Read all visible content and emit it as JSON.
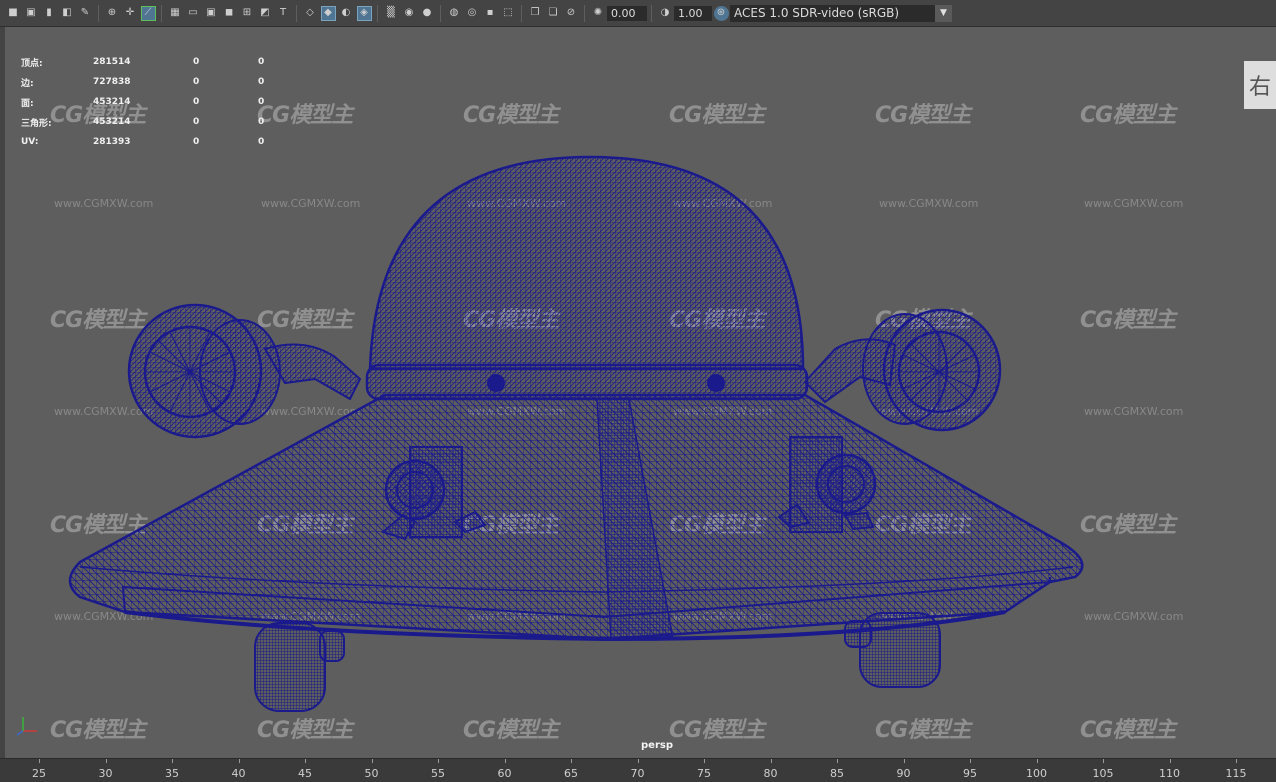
{
  "toolbar": {
    "exposure": "0.00",
    "gamma": "1.00",
    "colorspace": "ACES 1.0 SDR-video (sRGB)",
    "icons": [
      "camera-icon",
      "camera-attributes-icon",
      "bookmark-icon",
      "image-plane-icon",
      "grease-pencil-icon",
      "frame-all-icon",
      "pivot-icon",
      "wireframe-toggle-icon",
      "grid-icon",
      "film-gate-icon",
      "resolution-gate-icon",
      "gate-mask-icon",
      "field-chart-icon",
      "safe-action-icon",
      "safe-title-icon",
      "wireframe-shade-icon",
      "smooth-shade-icon",
      "textured-icon",
      "xray-joints-icon",
      "lights-icon",
      "shadows-icon",
      "ambient-occlusion-icon",
      "motion-blur-icon",
      "antialias-icon",
      "depth-of-field-icon",
      "isolate-select-icon",
      "xray-icon",
      "xray-active-icon",
      "backface-icon",
      "exposure-icon",
      "gamma-icon",
      "color-management-icon"
    ]
  },
  "hud": {
    "rows": [
      {
        "label": "顶点:",
        "total": "281514",
        "sel": "0",
        "comp": "0"
      },
      {
        "label": "边:",
        "total": "727838",
        "sel": "0",
        "comp": "0"
      },
      {
        "label": "面:",
        "total": "453214",
        "sel": "0",
        "comp": "0"
      },
      {
        "label": "三角形:",
        "total": "453214",
        "sel": "0",
        "comp": "0"
      },
      {
        "label": "UV:",
        "total": "281393",
        "sel": "0",
        "comp": "0"
      }
    ]
  },
  "viewport": {
    "camera": "persp",
    "side_label": "右",
    "watermark_logo": "CG模型主",
    "watermark_url": "www.CGMXW.com",
    "wire_color": "#1a1a8c",
    "background_color": "#5e5e5e"
  },
  "timeline": {
    "ticks": [
      "25",
      "30",
      "35",
      "40",
      "45",
      "50",
      "55",
      "60",
      "65",
      "70",
      "75",
      "80",
      "85",
      "90",
      "95",
      "100",
      "105",
      "110",
      "115"
    ]
  }
}
